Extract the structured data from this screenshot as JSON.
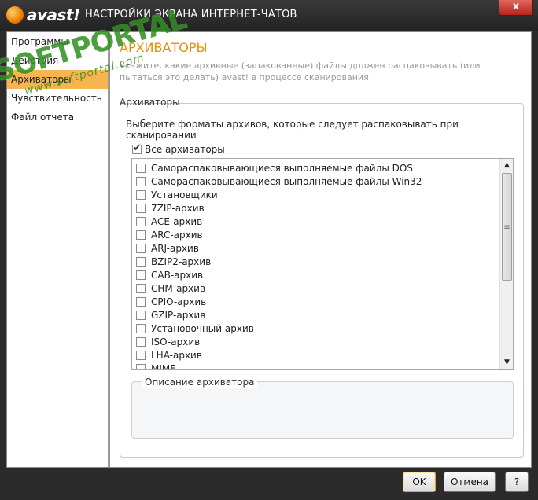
{
  "window": {
    "brand": "avast!",
    "title": "НАСТРОЙКИ ЭКРАНА ИНТЕРНЕТ-ЧАТОВ",
    "close_glyph": "x"
  },
  "sidebar": {
    "items": [
      {
        "label": "Программы"
      },
      {
        "label": "Действия"
      },
      {
        "label": "Архиваторы",
        "active": true
      },
      {
        "label": "Чувствительность"
      },
      {
        "label": "Файл отчета"
      }
    ]
  },
  "content": {
    "title": "АРХИВАТОРЫ",
    "description": "Укажите, какие архивные (запакованные) файлы должен распаковывать (или пытаться это делать) avast! в процессе сканирования.",
    "group_label": "Архиваторы",
    "instruction": "Выберите форматы архивов, которые следует распаковывать при сканировании",
    "all_label": "Все архиваторы",
    "all_checked": true,
    "formats": [
      "Самораспаковывающиеся выполняемые файлы DOS",
      "Самораспаковывающиеся выполняемые файлы Win32",
      "Установщики",
      "7ZIP-архив",
      "ACE-архив",
      "ARC-архив",
      "ARJ-архив",
      "BZIP2-архив",
      "CAB-архив",
      "CHM-архив",
      "CPIO-архив",
      "GZIP-архив",
      "Установочный архив",
      "ISO-архив",
      "LHA-архив",
      "MIME"
    ],
    "description_box_label": "Описание архиватора"
  },
  "buttons": {
    "ok": "OK",
    "cancel": "Отмена",
    "help": "?"
  },
  "watermark": {
    "main": "SOFTPORTAL",
    "sub": "www.softportal.com"
  },
  "colors": {
    "accent": "#f08c00",
    "active_nav": "#f7b550",
    "watermark": "#2f8f1f"
  }
}
